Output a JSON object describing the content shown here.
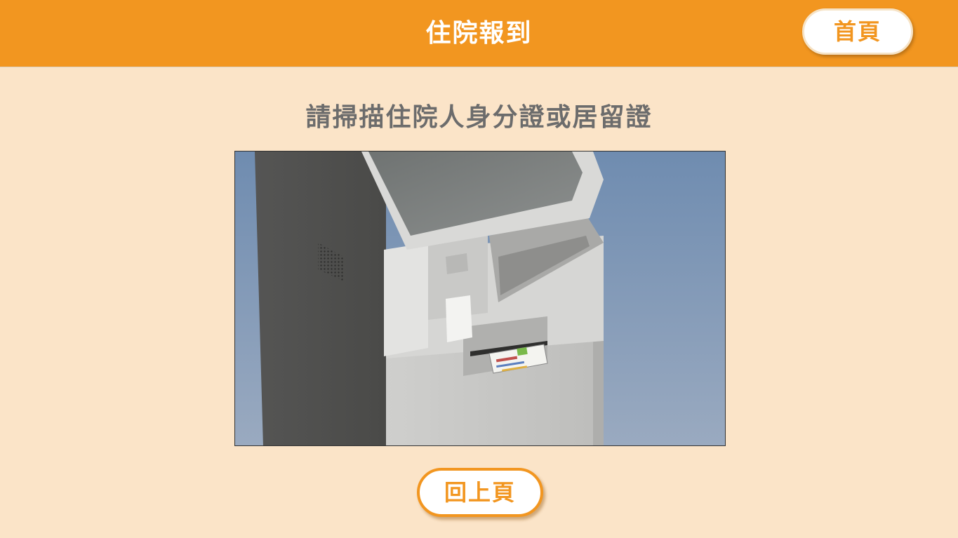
{
  "header": {
    "title": "住院報到",
    "home_button": "首頁"
  },
  "main": {
    "instruction": "請掃描住院人身分證或居留證",
    "illustration_subject": "kiosk-id-scanner-illustration"
  },
  "footer": {
    "back_button": "回上頁"
  },
  "colors": {
    "accent": "#f29620",
    "background": "#fbe4c8",
    "instruction_text": "#6c6c6c"
  }
}
